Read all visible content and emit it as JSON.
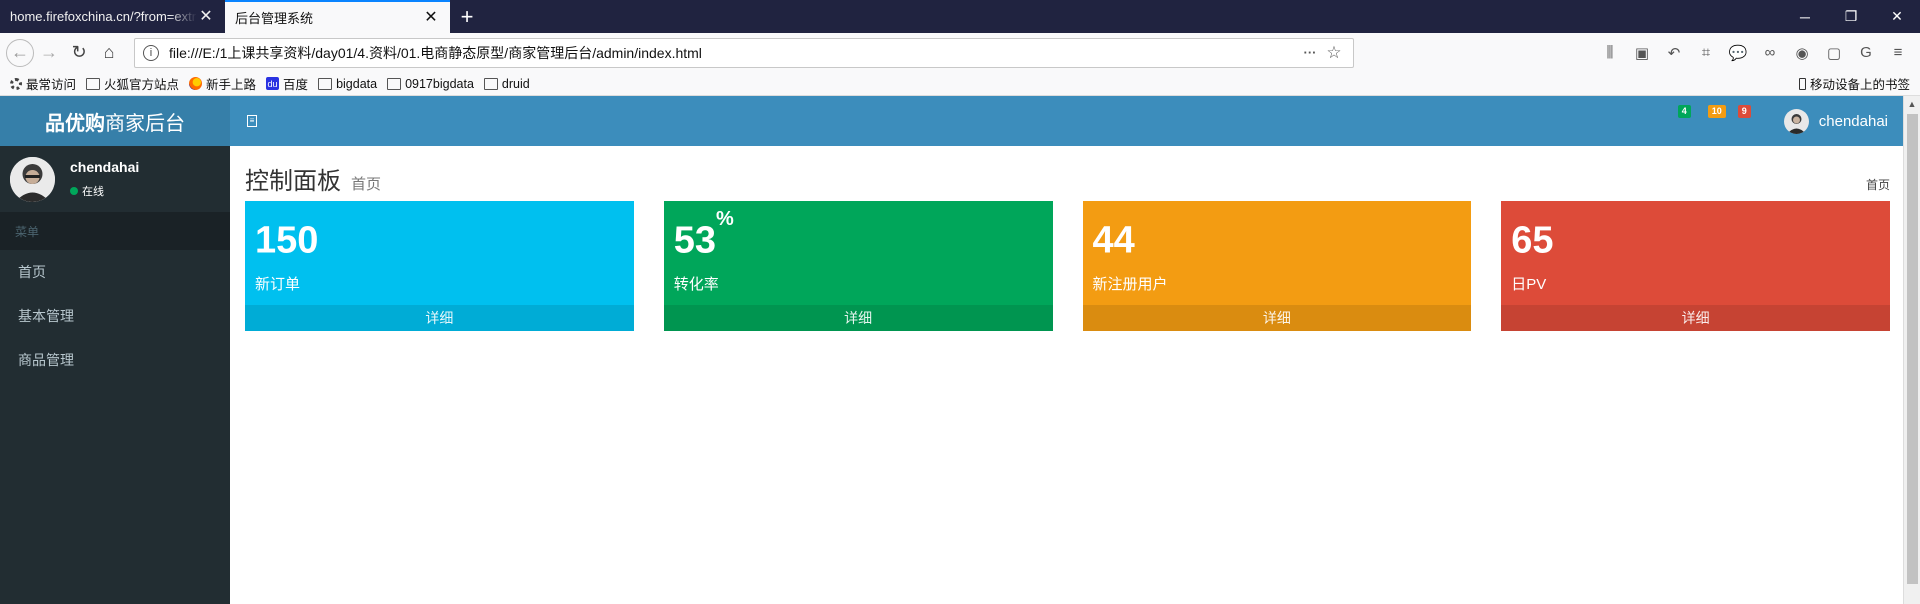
{
  "browser": {
    "tabs": [
      {
        "title": "home.firefoxchina.cn/?from=extra_start",
        "active": false
      },
      {
        "title": "后台管理系统",
        "active": true
      }
    ],
    "url": "file:///E:/1上课共享资料/day01/4.资料/01.电商静态原型/商家管理后台/admin/index.html",
    "bookmarks": [
      {
        "label": "最常访问",
        "icon": "gear-icon"
      },
      {
        "label": "火狐官方站点",
        "icon": "folder-icon"
      },
      {
        "label": "新手上路",
        "icon": "firefox-icon"
      },
      {
        "label": "百度",
        "icon": "baidu-icon"
      },
      {
        "label": "bigdata",
        "icon": "folder-icon"
      },
      {
        "label": "0917bigdata",
        "icon": "folder-icon"
      },
      {
        "label": "druid",
        "icon": "folder-icon"
      }
    ],
    "mobile_bookmarks": "移动设备上的书签"
  },
  "app": {
    "logo_bold": "品优购",
    "logo_rest": "商家后台",
    "notifications": [
      {
        "count": "4",
        "color": "#00a65a",
        "icon": "envelope-icon"
      },
      {
        "count": "10",
        "color": "#f39c12",
        "icon": "bell-icon"
      },
      {
        "count": "9",
        "color": "#dd4b39",
        "icon": "flag-icon"
      }
    ],
    "user": {
      "name": "chendahai",
      "status": "在线"
    }
  },
  "sidebar": {
    "header": "菜单",
    "items": [
      {
        "label": "首页"
      },
      {
        "label": "基本管理"
      },
      {
        "label": "商品管理"
      }
    ]
  },
  "content": {
    "title": "控制面板",
    "subtitle": "首页",
    "breadcrumb": "首页",
    "boxes": [
      {
        "value": "150",
        "suffix": "",
        "label": "新订单",
        "more": "详细",
        "color": "#00c0ef"
      },
      {
        "value": "53",
        "suffix": "%",
        "label": "转化率",
        "more": "详细",
        "color": "#00a65a"
      },
      {
        "value": "44",
        "suffix": "",
        "label": "新注册用户",
        "more": "详细",
        "color": "#f39c12"
      },
      {
        "value": "65",
        "suffix": "",
        "label": "日PV",
        "more": "详细",
        "color": "#dd4b39"
      }
    ]
  }
}
